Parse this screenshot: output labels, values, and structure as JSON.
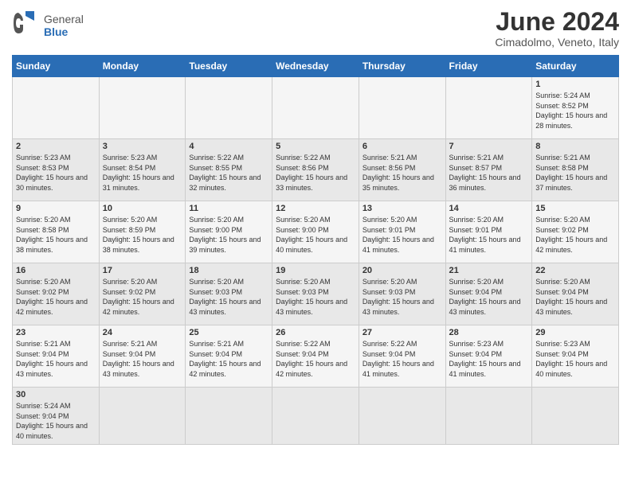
{
  "logo": {
    "text_general": "General",
    "text_blue": "Blue"
  },
  "title": "June 2024",
  "subtitle": "Cimadolmo, Veneto, Italy",
  "days_of_week": [
    "Sunday",
    "Monday",
    "Tuesday",
    "Wednesday",
    "Thursday",
    "Friday",
    "Saturday"
  ],
  "weeks": [
    [
      {
        "day": "",
        "info": ""
      },
      {
        "day": "",
        "info": ""
      },
      {
        "day": "",
        "info": ""
      },
      {
        "day": "",
        "info": ""
      },
      {
        "day": "",
        "info": ""
      },
      {
        "day": "",
        "info": ""
      },
      {
        "day": "1",
        "info": "Sunrise: 5:24 AM\nSunset: 8:52 PM\nDaylight: 15 hours\nand 28 minutes."
      }
    ],
    [
      {
        "day": "2",
        "info": "Sunrise: 5:23 AM\nSunset: 8:53 PM\nDaylight: 15 hours\nand 30 minutes."
      },
      {
        "day": "3",
        "info": "Sunrise: 5:23 AM\nSunset: 8:54 PM\nDaylight: 15 hours\nand 31 minutes."
      },
      {
        "day": "4",
        "info": "Sunrise: 5:22 AM\nSunset: 8:55 PM\nDaylight: 15 hours\nand 32 minutes."
      },
      {
        "day": "5",
        "info": "Sunrise: 5:22 AM\nSunset: 8:56 PM\nDaylight: 15 hours\nand 33 minutes."
      },
      {
        "day": "6",
        "info": "Sunrise: 5:21 AM\nSunset: 8:56 PM\nDaylight: 15 hours\nand 35 minutes."
      },
      {
        "day": "7",
        "info": "Sunrise: 5:21 AM\nSunset: 8:57 PM\nDaylight: 15 hours\nand 36 minutes."
      },
      {
        "day": "8",
        "info": "Sunrise: 5:21 AM\nSunset: 8:58 PM\nDaylight: 15 hours\nand 37 minutes."
      }
    ],
    [
      {
        "day": "9",
        "info": "Sunrise: 5:20 AM\nSunset: 8:58 PM\nDaylight: 15 hours\nand 38 minutes."
      },
      {
        "day": "10",
        "info": "Sunrise: 5:20 AM\nSunset: 8:59 PM\nDaylight: 15 hours\nand 38 minutes."
      },
      {
        "day": "11",
        "info": "Sunrise: 5:20 AM\nSunset: 9:00 PM\nDaylight: 15 hours\nand 39 minutes."
      },
      {
        "day": "12",
        "info": "Sunrise: 5:20 AM\nSunset: 9:00 PM\nDaylight: 15 hours\nand 40 minutes."
      },
      {
        "day": "13",
        "info": "Sunrise: 5:20 AM\nSunset: 9:01 PM\nDaylight: 15 hours\nand 41 minutes."
      },
      {
        "day": "14",
        "info": "Sunrise: 5:20 AM\nSunset: 9:01 PM\nDaylight: 15 hours\nand 41 minutes."
      },
      {
        "day": "15",
        "info": "Sunrise: 5:20 AM\nSunset: 9:02 PM\nDaylight: 15 hours\nand 42 minutes."
      }
    ],
    [
      {
        "day": "16",
        "info": "Sunrise: 5:20 AM\nSunset: 9:02 PM\nDaylight: 15 hours\nand 42 minutes."
      },
      {
        "day": "17",
        "info": "Sunrise: 5:20 AM\nSunset: 9:02 PM\nDaylight: 15 hours\nand 42 minutes."
      },
      {
        "day": "18",
        "info": "Sunrise: 5:20 AM\nSunset: 9:03 PM\nDaylight: 15 hours\nand 43 minutes."
      },
      {
        "day": "19",
        "info": "Sunrise: 5:20 AM\nSunset: 9:03 PM\nDaylight: 15 hours\nand 43 minutes."
      },
      {
        "day": "20",
        "info": "Sunrise: 5:20 AM\nSunset: 9:03 PM\nDaylight: 15 hours\nand 43 minutes."
      },
      {
        "day": "21",
        "info": "Sunrise: 5:20 AM\nSunset: 9:04 PM\nDaylight: 15 hours\nand 43 minutes."
      },
      {
        "day": "22",
        "info": "Sunrise: 5:20 AM\nSunset: 9:04 PM\nDaylight: 15 hours\nand 43 minutes."
      }
    ],
    [
      {
        "day": "23",
        "info": "Sunrise: 5:21 AM\nSunset: 9:04 PM\nDaylight: 15 hours\nand 43 minutes."
      },
      {
        "day": "24",
        "info": "Sunrise: 5:21 AM\nSunset: 9:04 PM\nDaylight: 15 hours\nand 43 minutes."
      },
      {
        "day": "25",
        "info": "Sunrise: 5:21 AM\nSunset: 9:04 PM\nDaylight: 15 hours\nand 42 minutes."
      },
      {
        "day": "26",
        "info": "Sunrise: 5:22 AM\nSunset: 9:04 PM\nDaylight: 15 hours\nand 42 minutes."
      },
      {
        "day": "27",
        "info": "Sunrise: 5:22 AM\nSunset: 9:04 PM\nDaylight: 15 hours\nand 41 minutes."
      },
      {
        "day": "28",
        "info": "Sunrise: 5:23 AM\nSunset: 9:04 PM\nDaylight: 15 hours\nand 41 minutes."
      },
      {
        "day": "29",
        "info": "Sunrise: 5:23 AM\nSunset: 9:04 PM\nDaylight: 15 hours\nand 40 minutes."
      }
    ],
    [
      {
        "day": "30",
        "info": "Sunrise: 5:24 AM\nSunset: 9:04 PM\nDaylight: 15 hours\nand 40 minutes."
      },
      {
        "day": "",
        "info": ""
      },
      {
        "day": "",
        "info": ""
      },
      {
        "day": "",
        "info": ""
      },
      {
        "day": "",
        "info": ""
      },
      {
        "day": "",
        "info": ""
      },
      {
        "day": "",
        "info": ""
      }
    ]
  ],
  "colors": {
    "header_bg": "#2a6db5",
    "row_odd": "#f5f5f5",
    "row_even": "#e8e8e8"
  }
}
